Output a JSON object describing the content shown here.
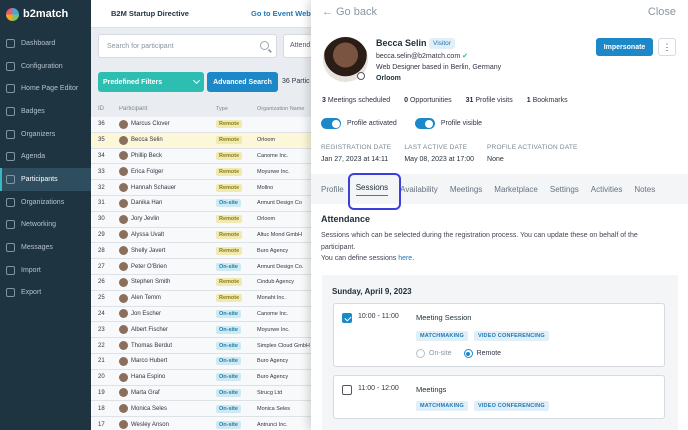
{
  "sidebar": {
    "brand": "b2match",
    "items": [
      {
        "label": "Dashboard",
        "icon": "dashboard-icon"
      },
      {
        "label": "Configuration",
        "icon": "configuration-icon"
      },
      {
        "label": "Home Page Editor",
        "icon": "home-page-editor-icon"
      },
      {
        "label": "Badges",
        "icon": "badges-icon"
      },
      {
        "label": "Organizers",
        "icon": "organizers-icon"
      },
      {
        "label": "Agenda",
        "icon": "agenda-icon"
      },
      {
        "label": "Participants",
        "icon": "participants-icon",
        "active": true
      },
      {
        "label": "Organizations",
        "icon": "organizations-icon"
      },
      {
        "label": "Networking",
        "icon": "networking-icon"
      },
      {
        "label": "Messages",
        "icon": "messages-icon"
      },
      {
        "label": "Import",
        "icon": "import-icon"
      },
      {
        "label": "Export",
        "icon": "export-icon"
      }
    ]
  },
  "topbar": {
    "event_title": "B2M Startup Directive",
    "event_link": "Go to Event Websi"
  },
  "list": {
    "search_placeholder": "Search for participant",
    "attendance_select": "Attend",
    "predefined_filters": "Predefined Filters",
    "advanced_search": "Advanced Search",
    "count": "36 Partic",
    "headers": {
      "id": "ID",
      "participant": "Participant",
      "type": "Type",
      "org": "Organization Name"
    },
    "rows": [
      {
        "id": "36",
        "name": "Marcus Clover",
        "type": "Remote",
        "org": ""
      },
      {
        "id": "35",
        "name": "Becca Selin",
        "type": "Remote",
        "org": "Orloom",
        "highlight": true
      },
      {
        "id": "34",
        "name": "Phillip Beck",
        "type": "Remote",
        "org": "Canome Inc."
      },
      {
        "id": "33",
        "name": "Erica Folger",
        "type": "Remote",
        "org": "Moyurwe Inc."
      },
      {
        "id": "32",
        "name": "Hannah Schauer",
        "type": "Remote",
        "org": "Mollno"
      },
      {
        "id": "31",
        "name": "Danika Han",
        "type": "On-site",
        "org": "Armunt Design Co"
      },
      {
        "id": "30",
        "name": "Jory Jevlin",
        "type": "Remote",
        "org": "Orloom"
      },
      {
        "id": "29",
        "name": "Alyssa Uvalt",
        "type": "Remote",
        "org": "Altuc Mond GmbH"
      },
      {
        "id": "28",
        "name": "Shelly Javert",
        "type": "Remote",
        "org": "Buro Agency"
      },
      {
        "id": "27",
        "name": "Peter O'Brien",
        "type": "On-site",
        "org": "Armunt Design Co."
      },
      {
        "id": "26",
        "name": "Stephen Smith",
        "type": "Remote",
        "org": "Cindub Agency"
      },
      {
        "id": "25",
        "name": "Alen Temm",
        "type": "Remote",
        "org": "Monaht Inc."
      },
      {
        "id": "24",
        "name": "Jon Escher",
        "type": "On-site",
        "org": "Canome Inc."
      },
      {
        "id": "23",
        "name": "Albert Fischer",
        "type": "On-site",
        "org": "Moyurwe Inc."
      },
      {
        "id": "22",
        "name": "Thomas Berdut",
        "type": "On-site",
        "org": "Simplex Cloud GmbH"
      },
      {
        "id": "21",
        "name": "Marco Hubert",
        "type": "On-site",
        "org": "Buro Agency"
      },
      {
        "id": "20",
        "name": "Hana Espino",
        "type": "On-site",
        "org": "Buro Agency"
      },
      {
        "id": "19",
        "name": "Marta Graf",
        "type": "On-site",
        "org": "Strucg Ltd"
      },
      {
        "id": "18",
        "name": "Monica Seles",
        "type": "On-site",
        "org": "Monica Seles"
      },
      {
        "id": "17",
        "name": "Wesley Anson",
        "type": "On-site",
        "org": "Antrunci Inc."
      }
    ]
  },
  "panel": {
    "back": "Go back",
    "close": "Close",
    "name": "Becca Selin",
    "role_badge": "Visitor",
    "email": "becca.selin@b2match.com",
    "job": "Web Designer based in Berlin, Germany",
    "organization": "Orloom",
    "impersonate": "Impersonate",
    "more": "⋮",
    "stats": [
      {
        "num": "3",
        "label": "Meetings scheduled"
      },
      {
        "num": "0",
        "label": "Opportunities"
      },
      {
        "num": "31",
        "label": "Profile visits"
      },
      {
        "num": "1",
        "label": "Bookmarks"
      }
    ],
    "toggle_activated": "Profile activated",
    "toggle_visible": "Profile visible",
    "dates": [
      {
        "label": "Registration Date",
        "value": "Jan 27, 2023 at 14:11"
      },
      {
        "label": "Last Active Date",
        "value": "May 08, 2023 at 17:00"
      },
      {
        "label": "Profile Activation Date",
        "value": "None"
      }
    ],
    "tabs": [
      "Profile",
      "Sessions",
      "Availability",
      "Meetings",
      "Marketplace",
      "Settings",
      "Activities",
      "Notes"
    ],
    "active_tab": "Sessions",
    "attendance_title": "Attendance",
    "attendance_desc": "Sessions which can be selected during the registration process. You can update these on behalf of the participant.",
    "define_prefix": "You can define sessions ",
    "define_link": "here",
    "define_suffix": ".",
    "day": "Sunday, April 9, 2023",
    "sessions": [
      {
        "time": "10:00 - 11:00",
        "name": "Meeting Session",
        "checked": true,
        "tags": [
          "MATCHMAKING",
          "VIDEO CONFERENCING"
        ],
        "radios": [
          "On-site",
          "Remote"
        ],
        "selected_radio": "Remote"
      },
      {
        "time": "11:00 - 12:00",
        "name": "Meetings",
        "checked": false,
        "tags": [
          "MATCHMAKING",
          "VIDEO CONFERENCING"
        ]
      }
    ]
  },
  "colors": {
    "sidebar": "#1e3441",
    "primary": "#1c88c7",
    "teal": "#2ebdb1",
    "tab_highlight": "#3b3fdb"
  }
}
